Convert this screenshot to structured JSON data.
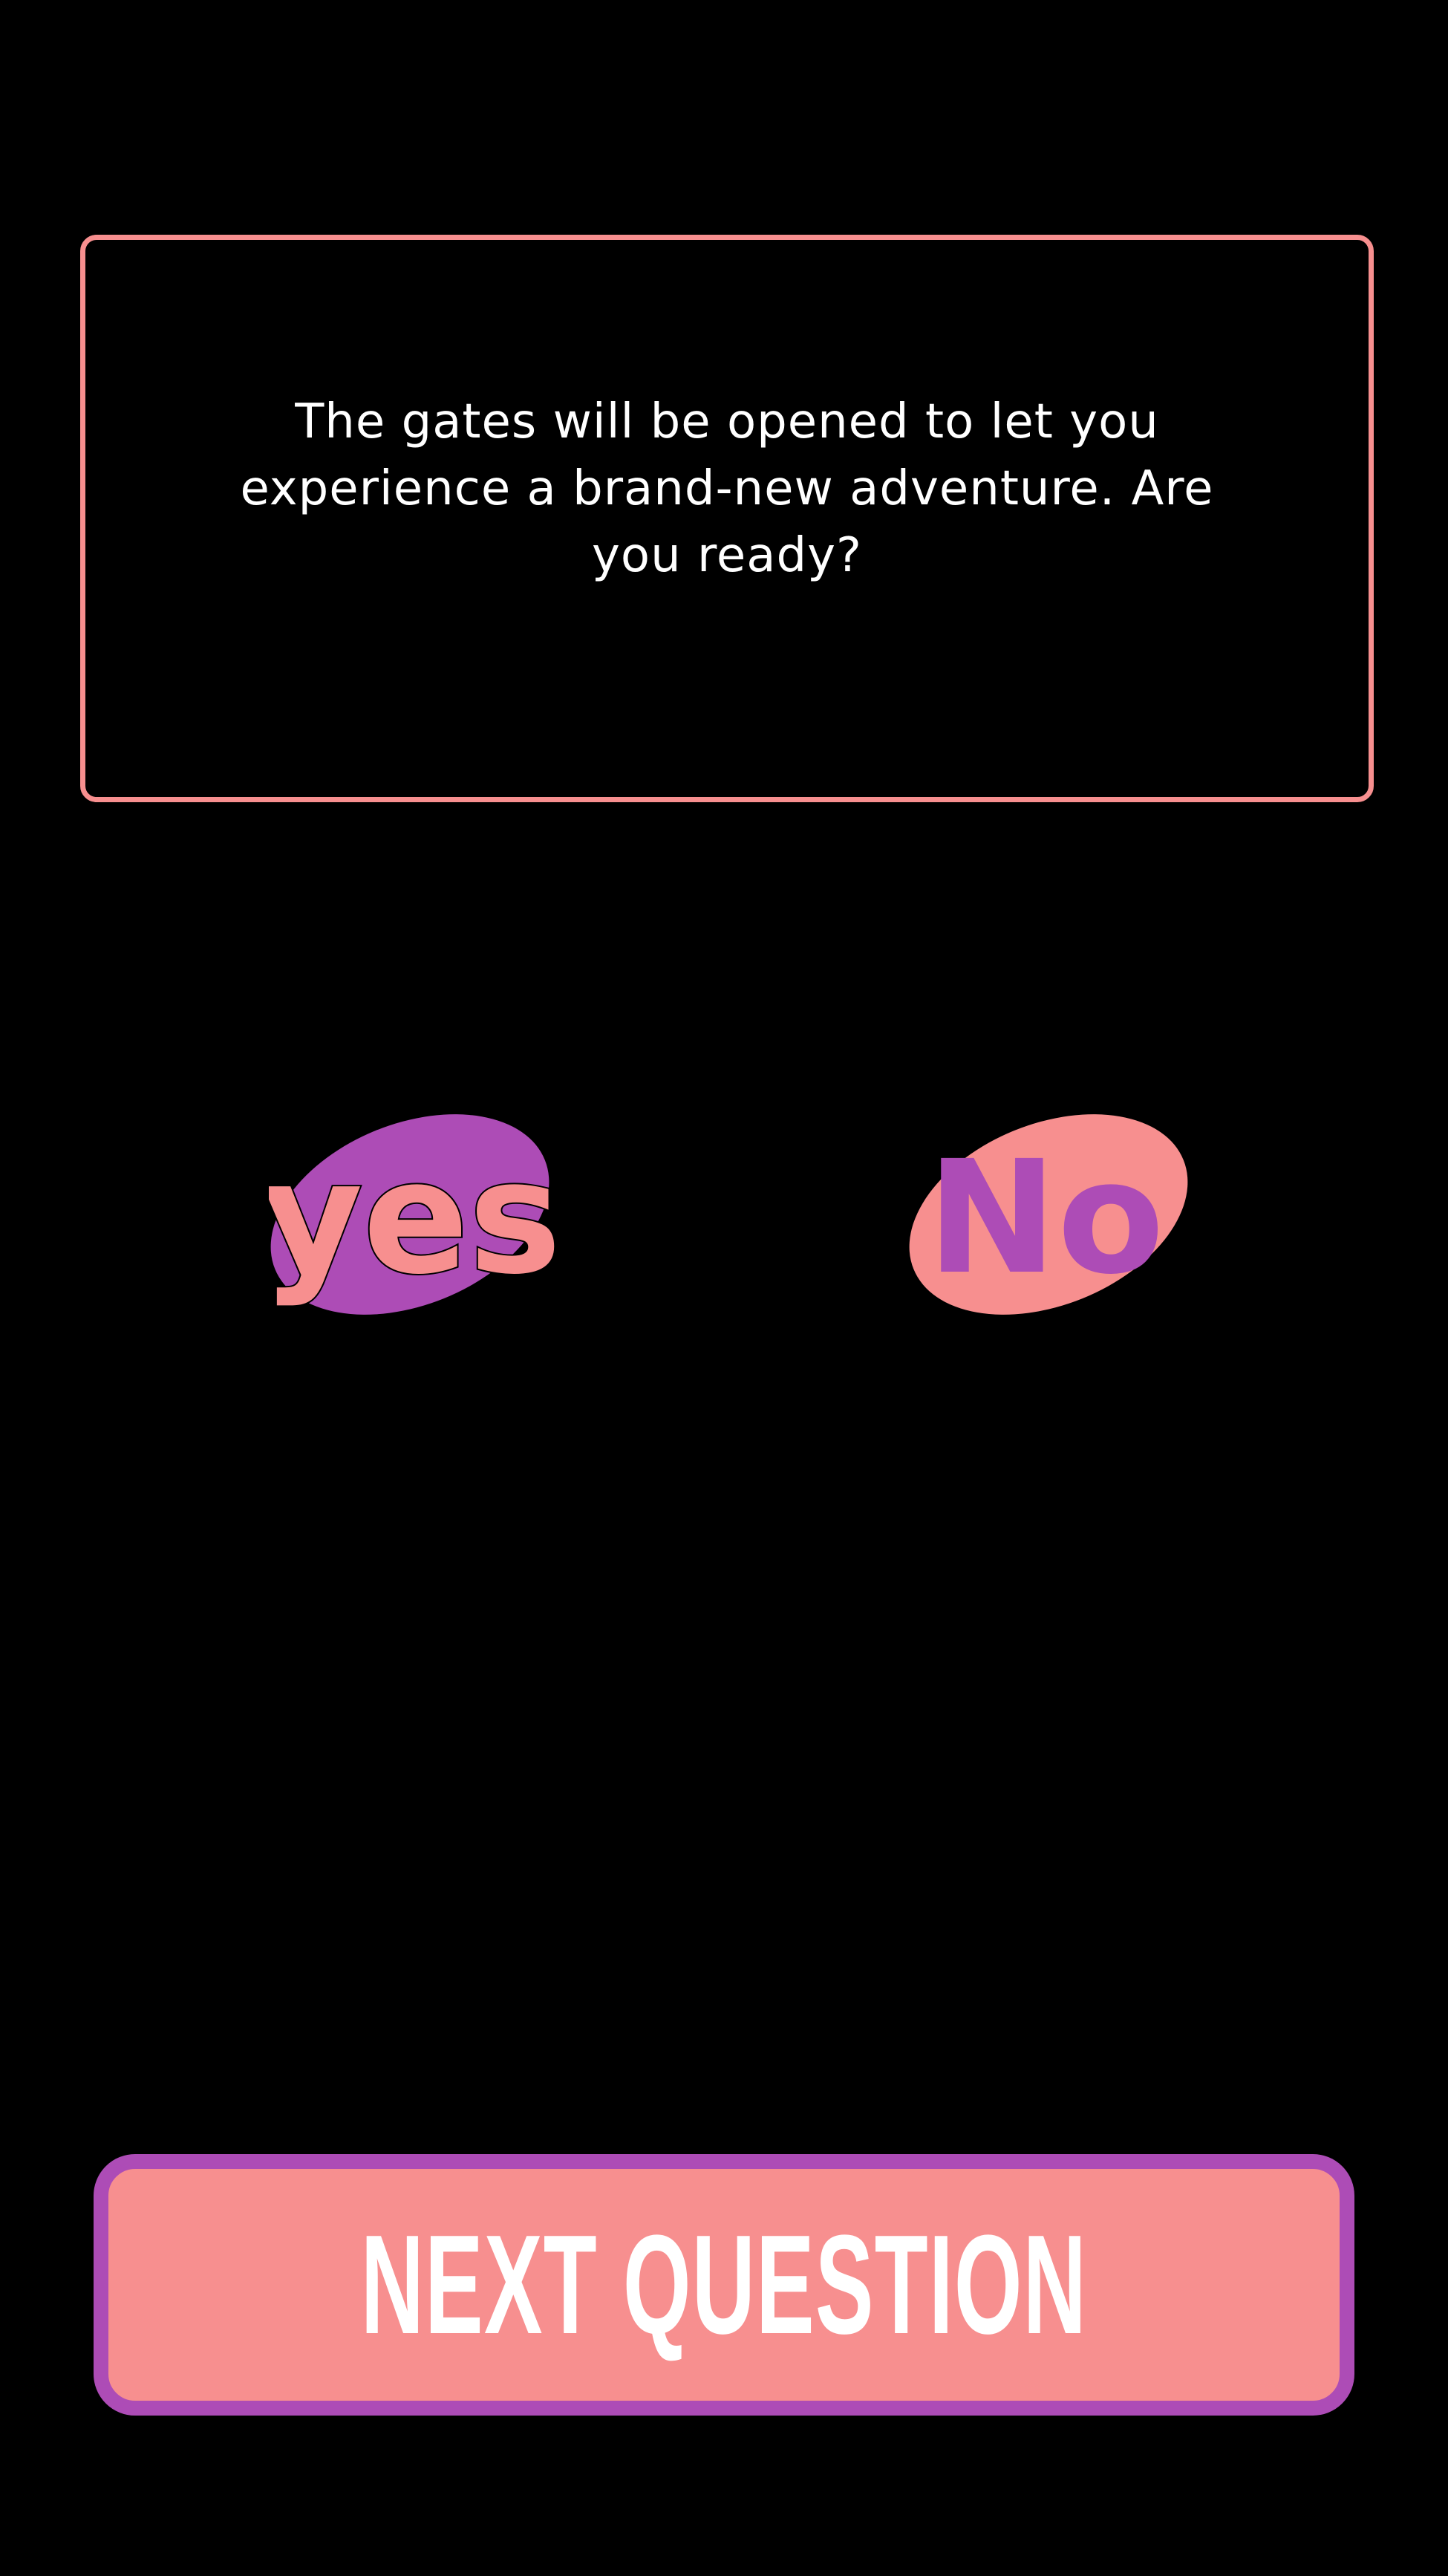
{
  "question": {
    "text": "The gates will be opened to let you experience a brand-new adventure. Are you ready?"
  },
  "answers": {
    "yes_label": "yes",
    "no_label": "No"
  },
  "next_button": {
    "label": "NEXT QUESTION"
  },
  "colors": {
    "background": "#000000",
    "coral": "#f78f8f",
    "purple": "#ad4cb6",
    "text": "#ffffff"
  }
}
